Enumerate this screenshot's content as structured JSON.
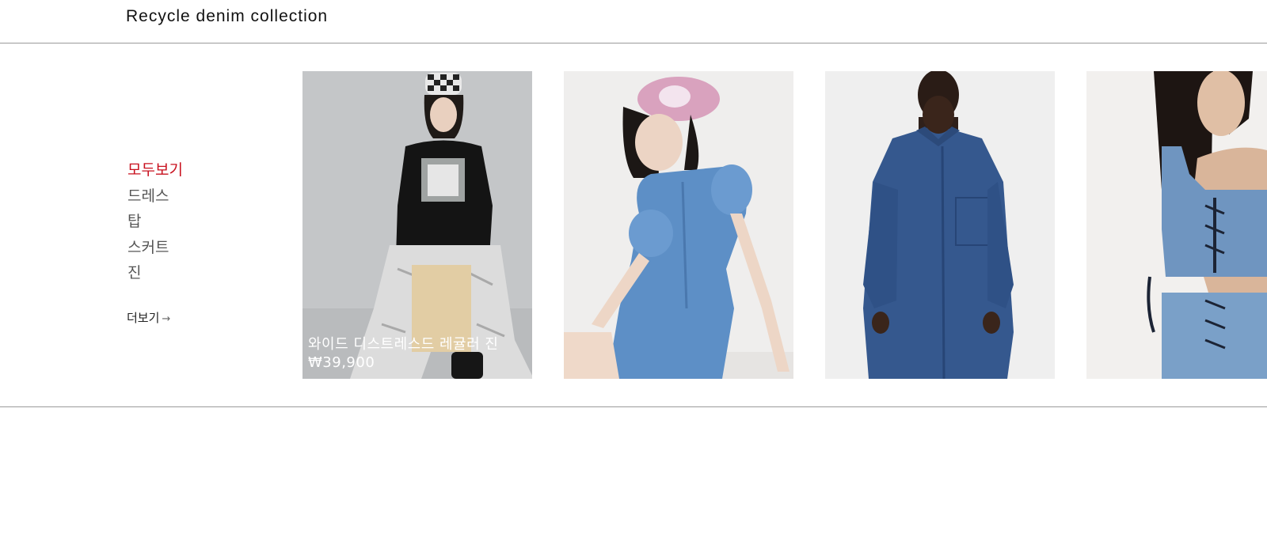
{
  "header": {
    "title": "Recycle denim collection"
  },
  "categories": {
    "items": [
      {
        "label": "모두보기",
        "active": true
      },
      {
        "label": "드레스"
      },
      {
        "label": "탑"
      },
      {
        "label": "스커트"
      },
      {
        "label": "진"
      }
    ],
    "more_label": "더보기",
    "more_arrow": "→"
  },
  "products": [
    {
      "name": "와이드 디스트레스드 레귤러 진",
      "price": "₩39,900"
    },
    {
      "name": "",
      "price": ""
    },
    {
      "name": "",
      "price": ""
    },
    {
      "name": "",
      "price": ""
    }
  ],
  "colors": {
    "accent": "#c8101e",
    "divider": "#9a9a9a"
  }
}
